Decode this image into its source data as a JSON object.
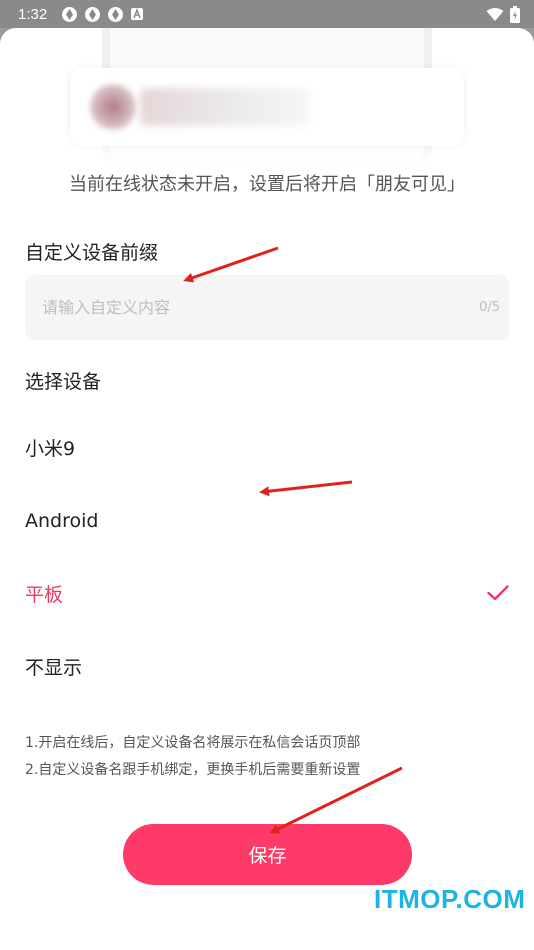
{
  "status_bar": {
    "time": "1:32",
    "icons": [
      "app-icon",
      "app-icon",
      "app-icon",
      "a-icon"
    ],
    "right_icons": [
      "wifi-icon",
      "battery-icon"
    ]
  },
  "notice": "当前在线状态未开启，设置后将开启「朋友可见」",
  "prefix": {
    "label": "自定义设备前缀",
    "placeholder": "请输入自定义内容",
    "value": "",
    "counter": "0/5"
  },
  "device": {
    "label": "选择设备",
    "options": [
      {
        "label": "小米9",
        "selected": false
      },
      {
        "label": "Android",
        "selected": false
      },
      {
        "label": "平板",
        "selected": true
      },
      {
        "label": "不显示",
        "selected": false
      }
    ],
    "check_icon": "✓"
  },
  "tips": [
    "1.开启在线后，自定义设备名将展示在私信会话页顶部",
    "2.自定义设备名跟手机绑定，更换手机后需要重新设置"
  ],
  "save_label": "保存",
  "watermark": "ITMOP.COM",
  "colors": {
    "accent": "#fe3b68",
    "selected_text": "#f03a63",
    "arrow": "#e0221f",
    "watermark": "#1cb4e6"
  }
}
